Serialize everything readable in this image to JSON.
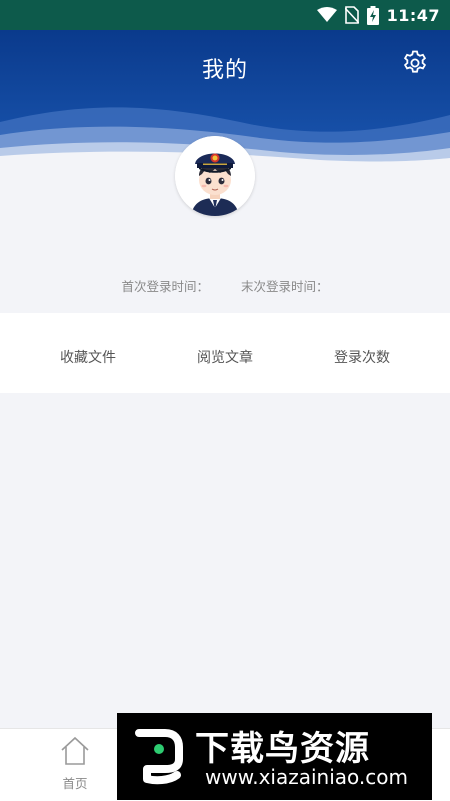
{
  "status_bar": {
    "time": "11:47"
  },
  "header": {
    "title": "我的"
  },
  "login_info": {
    "first_login": "首次登录时间：",
    "last_login": "末次登录时间："
  },
  "stats": [
    {
      "label": "收藏文件"
    },
    {
      "label": "阅览文章"
    },
    {
      "label": "登录次数"
    }
  ],
  "bottom_nav": {
    "home_label": "首页"
  },
  "watermark": {
    "title": "下载鸟资源",
    "url": "www.xiazainiao.com"
  },
  "colors": {
    "status_bar": "#0d5a4b",
    "header_blue": "#0b3f92",
    "background": "#f3f4f8"
  }
}
